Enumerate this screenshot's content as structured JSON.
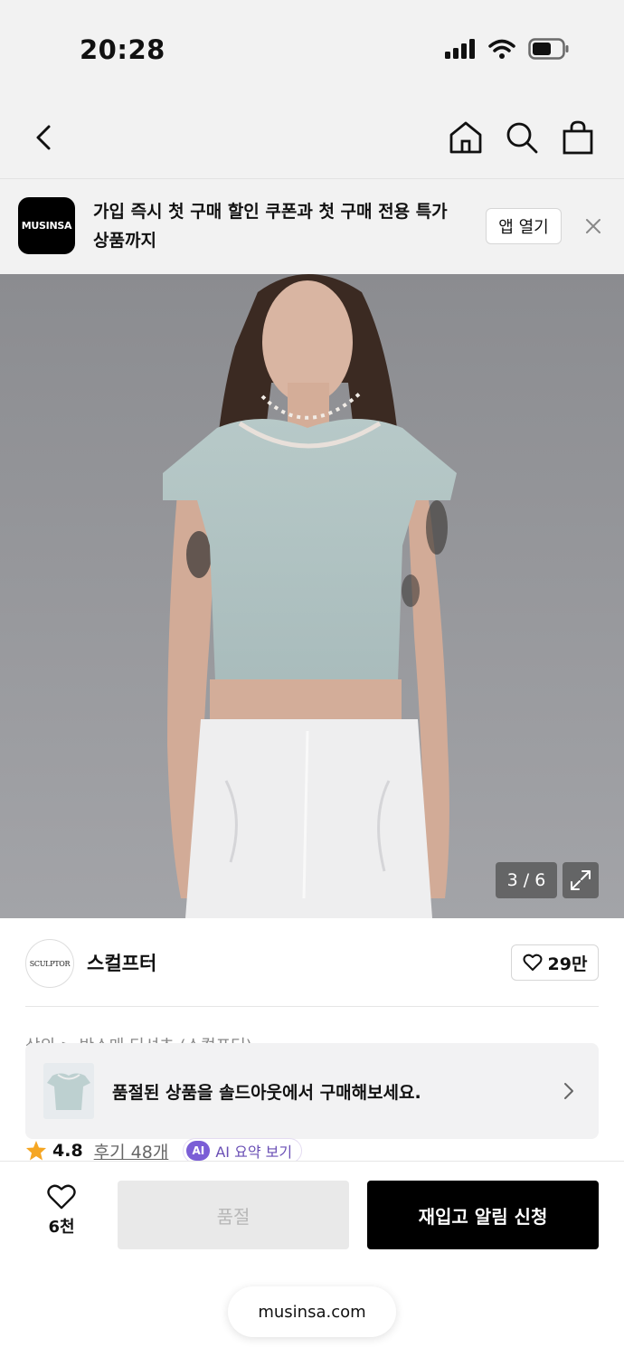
{
  "status_bar": {
    "time": "20:28"
  },
  "promo_banner": {
    "logo_text": "MUSINSA",
    "message": "가입 즉시 첫 구매 할인 쿠폰과 첫 구매 전용 특가 상품까지",
    "open_app_label": "앱 열기"
  },
  "product_image": {
    "counter": "3 / 6"
  },
  "brand": {
    "logo_text": "SCULPTOR",
    "name": "스컬프터",
    "likes": "29만"
  },
  "breadcrumb": "상의 > 반소매 티셔츠 (스컬프터)",
  "soldout_card": {
    "message": "품절된 상품을 솔드아웃에서 구매해보세요."
  },
  "rating": {
    "value": "4.8",
    "review_label": "후기 48개",
    "ai_badge": "AI",
    "ai_summary_label": "AI 요약 보기"
  },
  "bottom_bar": {
    "wish_count": "6천",
    "soldout_label": "품절",
    "restock_label": "재입고 알림 신청",
    "url": "musinsa.com"
  },
  "colors": {
    "primary_button": "#000000",
    "disabled_button": "#e9e9e9",
    "rating_star": "#f5a623",
    "ai_accent": "#7b5ed6"
  }
}
